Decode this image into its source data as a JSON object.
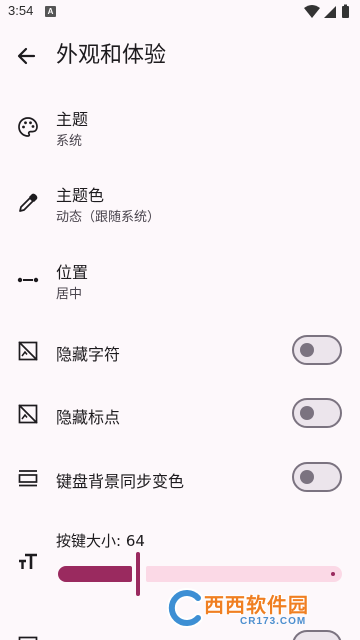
{
  "status_bar": {
    "time": "3:54",
    "notification_badge": "A",
    "icons": [
      "wifi-icon",
      "signal-icon",
      "battery-icon"
    ]
  },
  "app_bar": {
    "title": "外观和体验",
    "back_icon": "arrow-back-icon"
  },
  "settings": {
    "theme": {
      "title": "主题",
      "subtitle": "系统",
      "icon": "palette-icon"
    },
    "theme_color": {
      "title": "主题色",
      "subtitle": "动态（跟随系统）",
      "icon": "eyedropper-icon"
    },
    "position": {
      "title": "位置",
      "subtitle": "居中",
      "icon": "position-dots-icon"
    },
    "hide_chars": {
      "title": "隐藏字符",
      "icon": "hide-image-icon",
      "checked": false
    },
    "hide_punct": {
      "title": "隐藏标点",
      "icon": "hide-image-icon",
      "checked": false
    },
    "keyboard_bg_sync": {
      "title": "键盘背景同步变色",
      "icon": "keyboard-bar-icon",
      "checked": false
    },
    "key_size": {
      "title": "按键大小: 64",
      "icon": "text-size-icon",
      "value": 64,
      "fraction": 0.27
    }
  },
  "watermark": {
    "text": "西西软件园",
    "sub": "CR173.COM"
  },
  "colors": {
    "accent": "#9a2a5f",
    "track_inactive": "#fbd9e6",
    "switch_outline": "#7b7380",
    "background": "#fdf8fb"
  }
}
